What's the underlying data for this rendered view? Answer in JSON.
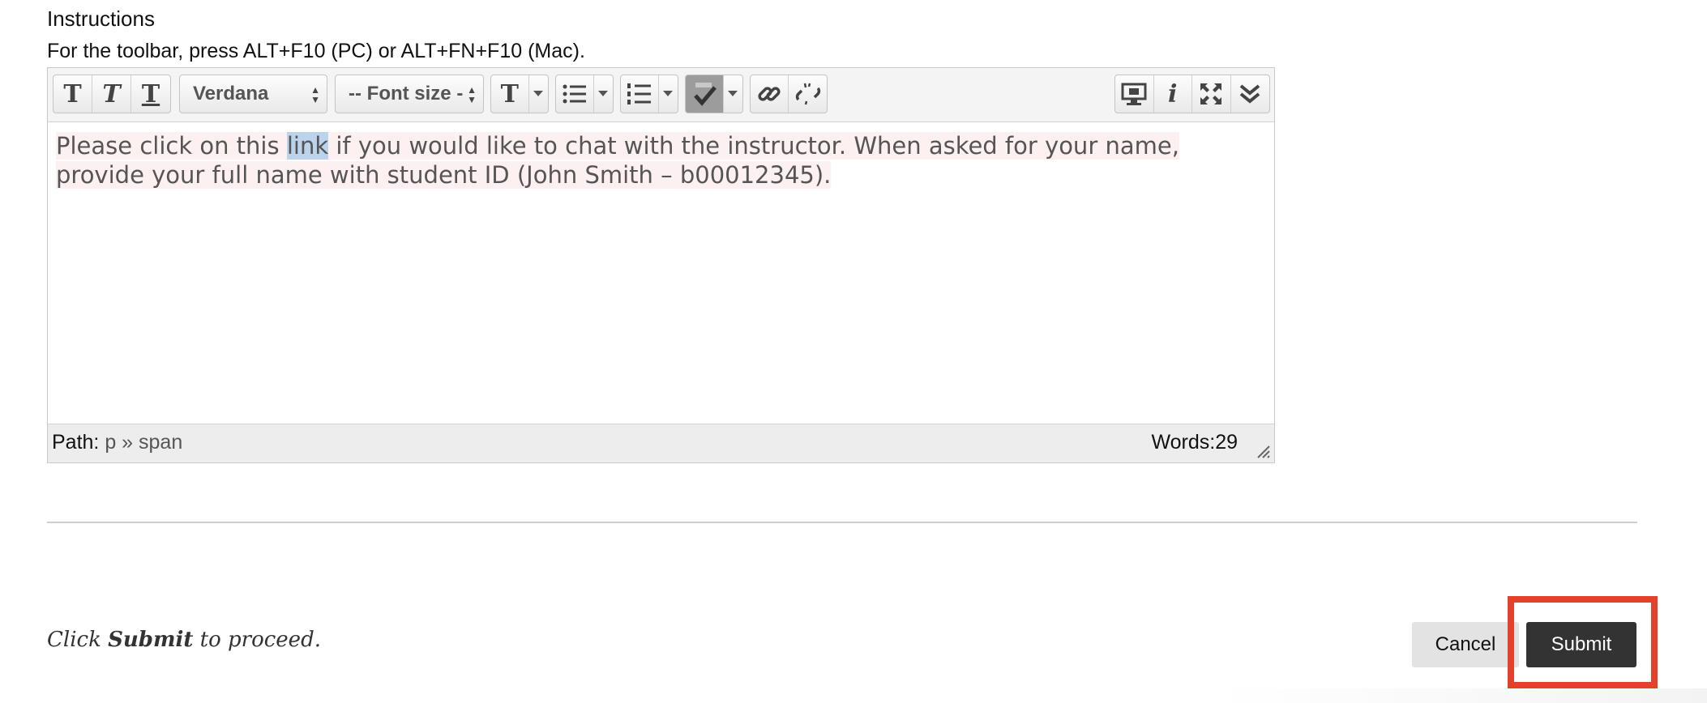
{
  "labels": {
    "instructions": "Instructions",
    "toolbar_hint": "For the toolbar, press ALT+F10 (PC) or ALT+FN+F10 (Mac)."
  },
  "toolbar": {
    "font_family": "Verdana",
    "font_size": "-- Font size -",
    "text_glyph": "T"
  },
  "editor": {
    "line1_before": "Please click on this ",
    "line1_link": "link",
    "line1_after": " if you would like to chat with the instructor. When asked for your name,",
    "line2": "provide your full name with student ID (John Smith – b00012345)."
  },
  "status": {
    "path_label": "Path:",
    "path_value": "p » span",
    "words_label": "Words:",
    "words_count": "29"
  },
  "footer": {
    "click": "Click",
    "submit_word": "Submit",
    "to_proceed": "to proceed.",
    "cancel_label": "Cancel",
    "submit_label": "Submit"
  },
  "colors": {
    "highlight_outline": "#e5402a",
    "submit_bg": "#333333",
    "cancel_bg": "#e3e3e3"
  }
}
